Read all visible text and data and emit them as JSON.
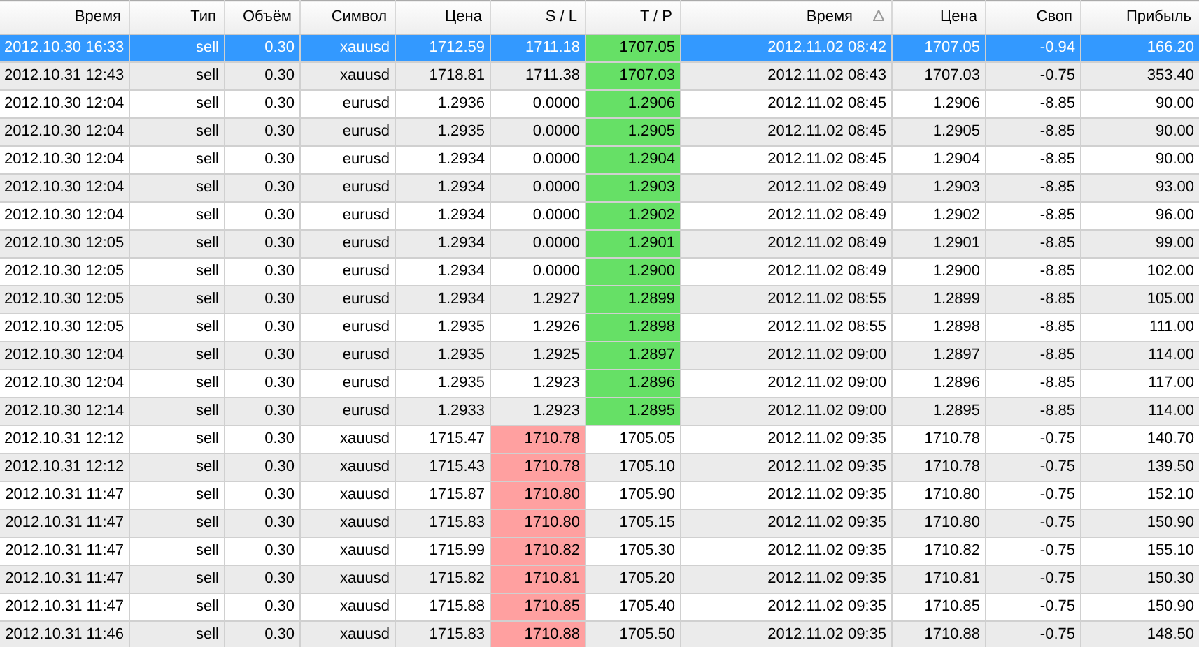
{
  "table": {
    "columns": [
      {
        "label": "Время",
        "sorted": false
      },
      {
        "label": "Тип",
        "sorted": false
      },
      {
        "label": "Объём",
        "sorted": false
      },
      {
        "label": "Символ",
        "sorted": false
      },
      {
        "label": "Цена",
        "sorted": false
      },
      {
        "label": "S / L",
        "sorted": false
      },
      {
        "label": "T / P",
        "sorted": false
      },
      {
        "label": "Время",
        "sorted": true
      },
      {
        "label": "Цена",
        "sorted": false
      },
      {
        "label": "Своп",
        "sorted": false
      },
      {
        "label": "Прибыль",
        "sorted": false
      }
    ],
    "rows": [
      {
        "selected": true,
        "sl_highlighted": false,
        "tp_highlighted": true,
        "cells": [
          "2012.10.30 16:33",
          "sell",
          "0.30",
          "xauusd",
          "1712.59",
          "1711.18",
          "1707.05",
          "2012.11.02 08:42",
          "1707.05",
          "-0.94",
          "166.20"
        ]
      },
      {
        "selected": false,
        "sl_highlighted": false,
        "tp_highlighted": true,
        "cells": [
          "2012.10.31 12:43",
          "sell",
          "0.30",
          "xauusd",
          "1718.81",
          "1711.38",
          "1707.03",
          "2012.11.02 08:43",
          "1707.03",
          "-0.75",
          "353.40"
        ]
      },
      {
        "selected": false,
        "sl_highlighted": false,
        "tp_highlighted": true,
        "cells": [
          "2012.10.30 12:04",
          "sell",
          "0.30",
          "eurusd",
          "1.2936",
          "0.0000",
          "1.2906",
          "2012.11.02 08:45",
          "1.2906",
          "-8.85",
          "90.00"
        ]
      },
      {
        "selected": false,
        "sl_highlighted": false,
        "tp_highlighted": true,
        "cells": [
          "2012.10.30 12:04",
          "sell",
          "0.30",
          "eurusd",
          "1.2935",
          "0.0000",
          "1.2905",
          "2012.11.02 08:45",
          "1.2905",
          "-8.85",
          "90.00"
        ]
      },
      {
        "selected": false,
        "sl_highlighted": false,
        "tp_highlighted": true,
        "cells": [
          "2012.10.30 12:04",
          "sell",
          "0.30",
          "eurusd",
          "1.2934",
          "0.0000",
          "1.2904",
          "2012.11.02 08:45",
          "1.2904",
          "-8.85",
          "90.00"
        ]
      },
      {
        "selected": false,
        "sl_highlighted": false,
        "tp_highlighted": true,
        "cells": [
          "2012.10.30 12:04",
          "sell",
          "0.30",
          "eurusd",
          "1.2934",
          "0.0000",
          "1.2903",
          "2012.11.02 08:49",
          "1.2903",
          "-8.85",
          "93.00"
        ]
      },
      {
        "selected": false,
        "sl_highlighted": false,
        "tp_highlighted": true,
        "cells": [
          "2012.10.30 12:04",
          "sell",
          "0.30",
          "eurusd",
          "1.2934",
          "0.0000",
          "1.2902",
          "2012.11.02 08:49",
          "1.2902",
          "-8.85",
          "96.00"
        ]
      },
      {
        "selected": false,
        "sl_highlighted": false,
        "tp_highlighted": true,
        "cells": [
          "2012.10.30 12:05",
          "sell",
          "0.30",
          "eurusd",
          "1.2934",
          "0.0000",
          "1.2901",
          "2012.11.02 08:49",
          "1.2901",
          "-8.85",
          "99.00"
        ]
      },
      {
        "selected": false,
        "sl_highlighted": false,
        "tp_highlighted": true,
        "cells": [
          "2012.10.30 12:05",
          "sell",
          "0.30",
          "eurusd",
          "1.2934",
          "0.0000",
          "1.2900",
          "2012.11.02 08:49",
          "1.2900",
          "-8.85",
          "102.00"
        ]
      },
      {
        "selected": false,
        "sl_highlighted": false,
        "tp_highlighted": true,
        "cells": [
          "2012.10.30 12:05",
          "sell",
          "0.30",
          "eurusd",
          "1.2934",
          "1.2927",
          "1.2899",
          "2012.11.02 08:55",
          "1.2899",
          "-8.85",
          "105.00"
        ]
      },
      {
        "selected": false,
        "sl_highlighted": false,
        "tp_highlighted": true,
        "cells": [
          "2012.10.30 12:05",
          "sell",
          "0.30",
          "eurusd",
          "1.2935",
          "1.2926",
          "1.2898",
          "2012.11.02 08:55",
          "1.2898",
          "-8.85",
          "111.00"
        ]
      },
      {
        "selected": false,
        "sl_highlighted": false,
        "tp_highlighted": true,
        "cells": [
          "2012.10.30 12:04",
          "sell",
          "0.30",
          "eurusd",
          "1.2935",
          "1.2925",
          "1.2897",
          "2012.11.02 09:00",
          "1.2897",
          "-8.85",
          "114.00"
        ]
      },
      {
        "selected": false,
        "sl_highlighted": false,
        "tp_highlighted": true,
        "cells": [
          "2012.10.30 12:04",
          "sell",
          "0.30",
          "eurusd",
          "1.2935",
          "1.2923",
          "1.2896",
          "2012.11.02 09:00",
          "1.2896",
          "-8.85",
          "117.00"
        ]
      },
      {
        "selected": false,
        "sl_highlighted": false,
        "tp_highlighted": true,
        "cells": [
          "2012.10.30 12:14",
          "sell",
          "0.30",
          "eurusd",
          "1.2933",
          "1.2923",
          "1.2895",
          "2012.11.02 09:00",
          "1.2895",
          "-8.85",
          "114.00"
        ]
      },
      {
        "selected": false,
        "sl_highlighted": true,
        "tp_highlighted": false,
        "cells": [
          "2012.10.31 12:12",
          "sell",
          "0.30",
          "xauusd",
          "1715.47",
          "1710.78",
          "1705.05",
          "2012.11.02 09:35",
          "1710.78",
          "-0.75",
          "140.70"
        ]
      },
      {
        "selected": false,
        "sl_highlighted": true,
        "tp_highlighted": false,
        "cells": [
          "2012.10.31 12:12",
          "sell",
          "0.30",
          "xauusd",
          "1715.43",
          "1710.78",
          "1705.10",
          "2012.11.02 09:35",
          "1710.78",
          "-0.75",
          "139.50"
        ]
      },
      {
        "selected": false,
        "sl_highlighted": true,
        "tp_highlighted": false,
        "cells": [
          "2012.10.31 11:47",
          "sell",
          "0.30",
          "xauusd",
          "1715.87",
          "1710.80",
          "1705.90",
          "2012.11.02 09:35",
          "1710.80",
          "-0.75",
          "152.10"
        ]
      },
      {
        "selected": false,
        "sl_highlighted": true,
        "tp_highlighted": false,
        "cells": [
          "2012.10.31 11:47",
          "sell",
          "0.30",
          "xauusd",
          "1715.83",
          "1710.80",
          "1705.15",
          "2012.11.02 09:35",
          "1710.80",
          "-0.75",
          "150.90"
        ]
      },
      {
        "selected": false,
        "sl_highlighted": true,
        "tp_highlighted": false,
        "cells": [
          "2012.10.31 11:47",
          "sell",
          "0.30",
          "xauusd",
          "1715.99",
          "1710.82",
          "1705.30",
          "2012.11.02 09:35",
          "1710.82",
          "-0.75",
          "155.10"
        ]
      },
      {
        "selected": false,
        "sl_highlighted": true,
        "tp_highlighted": false,
        "cells": [
          "2012.10.31 11:47",
          "sell",
          "0.30",
          "xauusd",
          "1715.82",
          "1710.81",
          "1705.20",
          "2012.11.02 09:35",
          "1710.81",
          "-0.75",
          "150.30"
        ]
      },
      {
        "selected": false,
        "sl_highlighted": true,
        "tp_highlighted": false,
        "cells": [
          "2012.10.31 11:47",
          "sell",
          "0.30",
          "xauusd",
          "1715.88",
          "1710.85",
          "1705.40",
          "2012.11.02 09:35",
          "1710.85",
          "-0.75",
          "150.90"
        ]
      },
      {
        "selected": false,
        "sl_highlighted": true,
        "tp_highlighted": false,
        "cells": [
          "2012.10.31 11:46",
          "sell",
          "0.30",
          "xauusd",
          "1715.83",
          "1710.88",
          "1705.50",
          "2012.11.02 09:35",
          "1710.88",
          "-0.75",
          "148.50"
        ]
      }
    ]
  }
}
